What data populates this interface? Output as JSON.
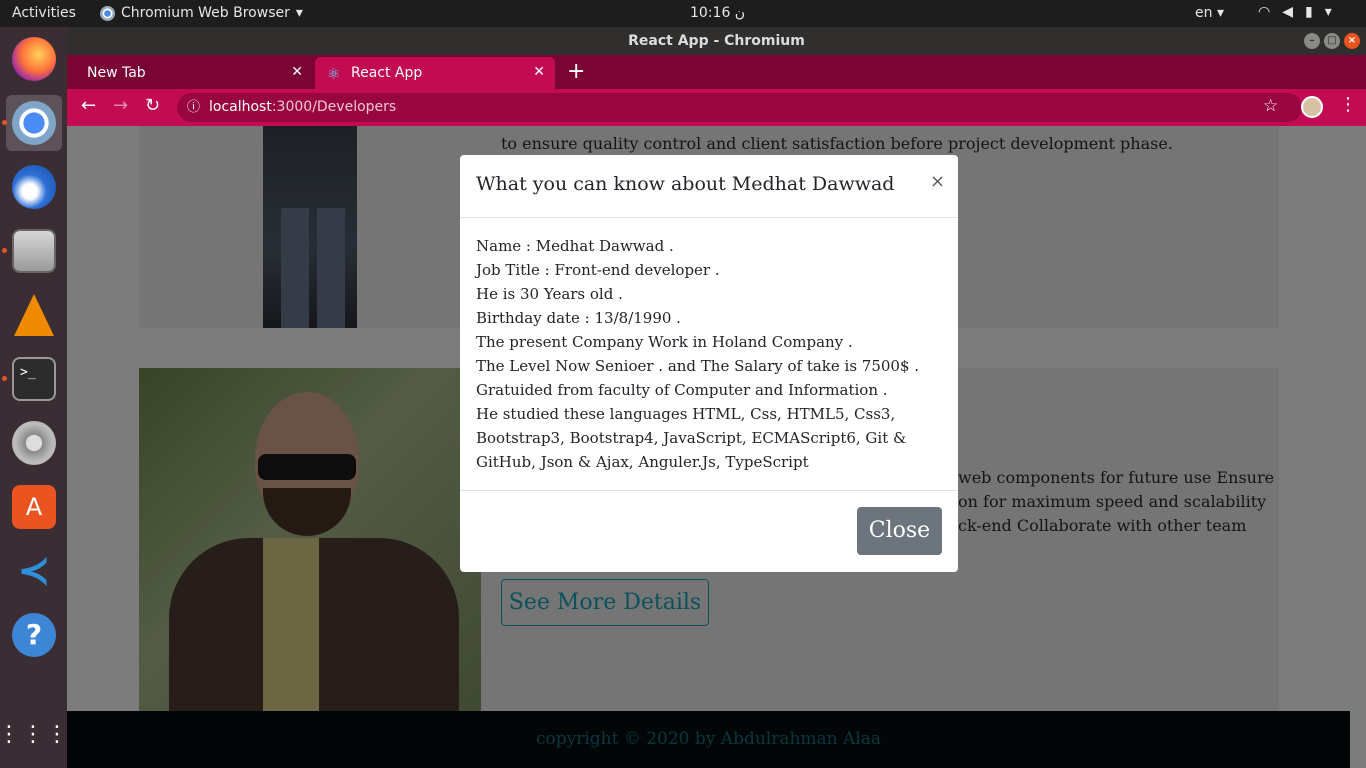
{
  "topbar": {
    "activities": "Activities",
    "app_name": "Chromium Web Browser",
    "clock": "10:16 ن",
    "lang": "en"
  },
  "dock": {
    "items": [
      "firefox-icon",
      "chromium-icon",
      "thunderbird-icon",
      "files-icon",
      "vlc-icon",
      "terminal-icon",
      "settings-icon",
      "software-icon",
      "vscode-icon",
      "help-icon",
      "apps-grid-icon"
    ]
  },
  "window": {
    "title": "React App - Chromium"
  },
  "tabs": [
    {
      "label": "New Tab"
    },
    {
      "label": "React App"
    }
  ],
  "omnibox": {
    "host": "localhost",
    "path": ":3000/Developers"
  },
  "page": {
    "top_text": "to ensure quality control and client satisfaction before project development phase.",
    "right_text_1": "web components for future use Ensure",
    "right_text_2": "on for maximum speed and scalability",
    "right_text_3": "ck-end Collaborate with other team",
    "details_button": "See More Details",
    "footer": "copyright © 2020 by Abdulrahman Alaa"
  },
  "modal": {
    "title": "What you can know about Medhat Dawwad",
    "close_symbol": "×",
    "lines": [
      "Name : Medhat Dawwad .",
      "Job Title : Front-end developer .",
      "He is 30 Years old .",
      "Birthday date : 13/8/1990 .",
      "The present Company Work in Holand Company .",
      "The Level Now Senioer . and The Salary of take is 7500$ .",
      "Gratuided from faculty of Computer and Information .",
      "He studied these languages HTML, Css, HTML5, Css3,",
      "Bootstrap3, Bootstrap4, JavaScript, ECMAScript6, Git &",
      "GitHub, Json & Ajax, Anguler.Js, TypeScript"
    ],
    "close_button": "Close"
  }
}
